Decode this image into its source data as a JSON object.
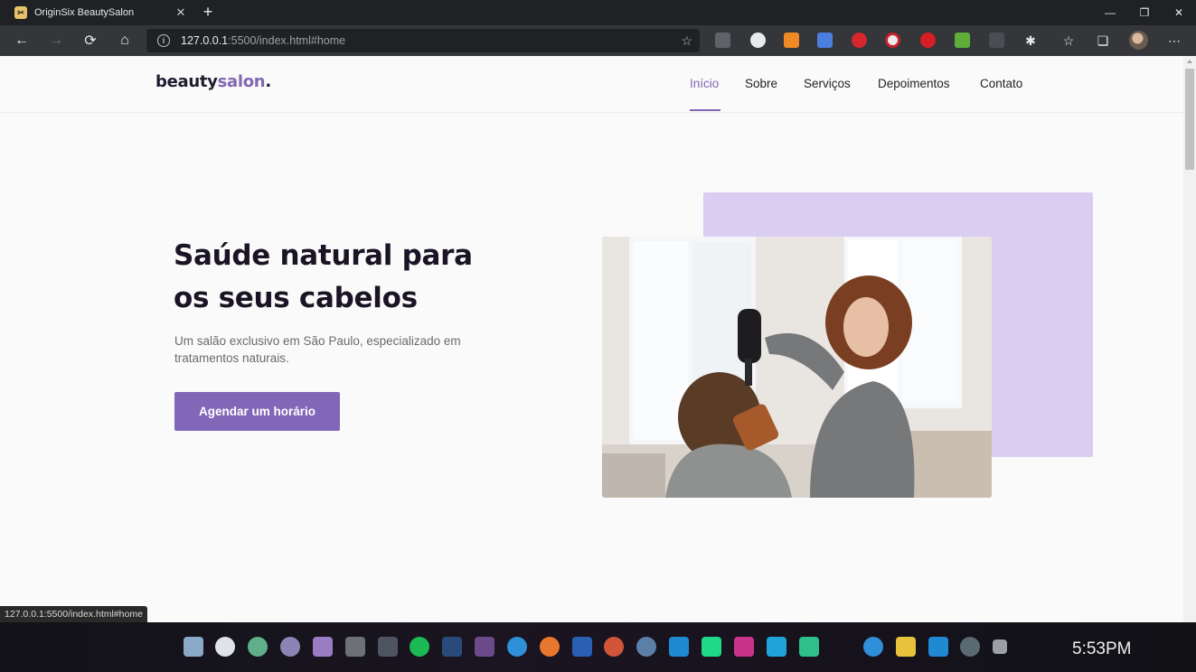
{
  "browser": {
    "tab_title": "OriginSix BeautySalon",
    "tab_favicon": "salon-favicon",
    "url_host": "127.0.0.1",
    "url_rest": ":5500/index.html#home",
    "status_url": "127.0.0.1:5500/index.html#home"
  },
  "site": {
    "logo_main": "beauty",
    "logo_accent": "salon",
    "logo_dot": ".",
    "accent_color": "#7f67b3",
    "nav": [
      {
        "label": "Início",
        "active": true
      },
      {
        "label": "Sobre",
        "active": false
      },
      {
        "label": "Serviços",
        "active": false
      },
      {
        "label": "Depoimentos",
        "active": false
      },
      {
        "label": "Contato",
        "active": false
      }
    ]
  },
  "hero": {
    "title": "Saúde natural para os seus cabelos",
    "subtitle": "Um salão exclusivo em São Paulo, especializado em tratamentos naturais.",
    "cta_label": "Agendar um horário",
    "image": "hairdresser-drying-client-hair-photo"
  },
  "taskbar": {
    "clock": "5:53PM",
    "apps": [
      "windows-icon",
      "power-icon",
      "refresh-app-icon",
      "moon-app-icon",
      "tasks-app-icon",
      "monitor-app-icon",
      "trash-icon",
      "spotify-icon",
      "photoshop-icon",
      "premiere-icon",
      "edge-icon",
      "firefox-icon",
      "word-icon",
      "powerpoint-icon",
      "search-app-icon",
      "vscode-icon",
      "pycharm-icon",
      "intellij-icon",
      "webstorm-icon",
      "clion-icon",
      "edge-icon",
      "files-icon",
      "vscode-icon",
      "back-app-icon"
    ]
  }
}
